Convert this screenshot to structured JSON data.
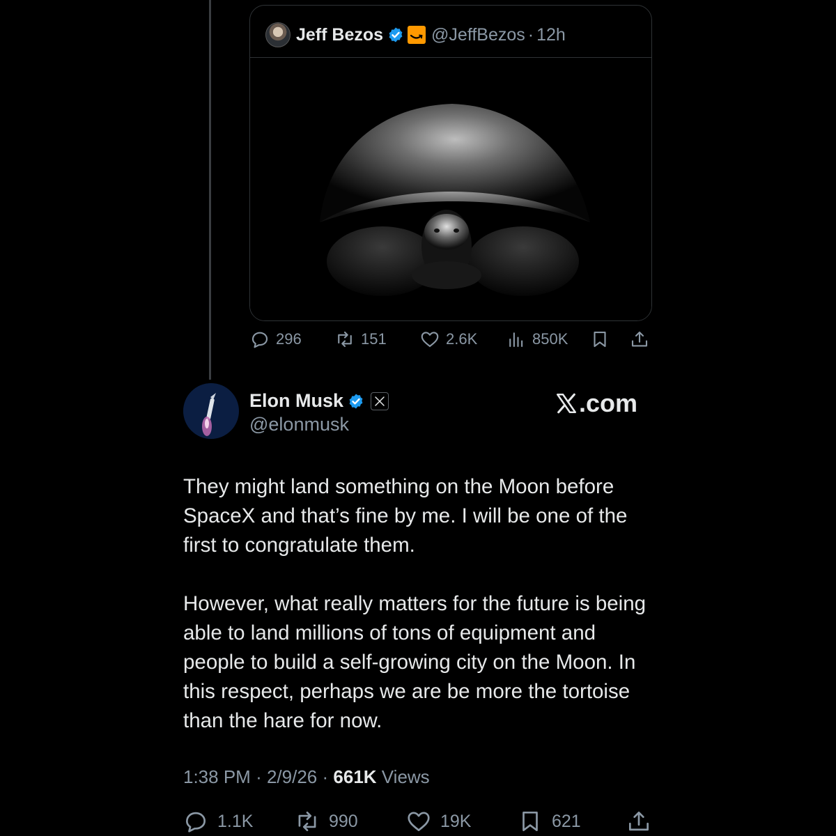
{
  "quoted": {
    "name": "Jeff Bezos",
    "handle": "@JeffBezos",
    "dot": "·",
    "time": "12h",
    "actions": {
      "replies": "296",
      "reposts": "151",
      "likes": "2.6K",
      "views": "850K"
    }
  },
  "tweet": {
    "name": "Elon Musk",
    "handle": "@elonmusk",
    "brand": ".com",
    "text": "They might land something on the Moon before SpaceX and that’s fine by me. I will be one of the first to congratulate them.\n\nHowever, what really matters for the future is being able to land millions of tons of equipment and people to build a self-growing city on the Moon. In this respect, perhaps we are be more the tortoise than the hare for now.",
    "time": "1:38 PM",
    "date": "2/9/26",
    "views_count": "661K",
    "views_label": "Views",
    "actions": {
      "replies": "1.1K",
      "reposts": "990",
      "likes": "19K",
      "bookmarks": "621"
    }
  },
  "colors": {
    "background": "#000000",
    "text": "#e7e9ea",
    "muted": "#8b98a5",
    "verified": "#1d9bf0",
    "amazon": "#ff9900"
  }
}
